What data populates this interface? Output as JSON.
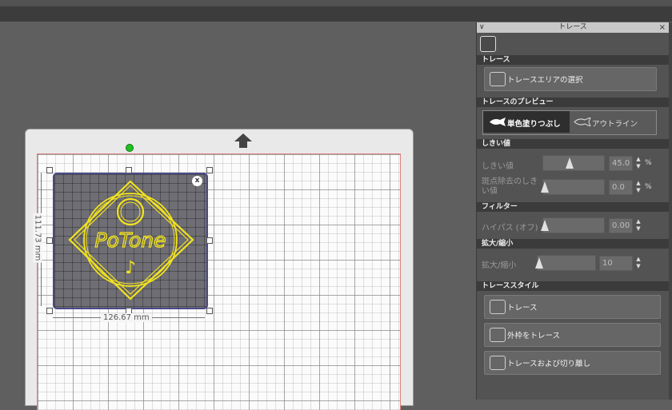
{
  "panel": {
    "title": "トレース",
    "sections": {
      "trace": "トレース",
      "preview": "トレースのプレビュー",
      "threshold": "しきい値",
      "filter": "フィルター",
      "scale": "拡大/縮小",
      "style": "トレーススタイル"
    },
    "select_area_button": "トレースエリアの選択",
    "preview_modes": {
      "fill": "単色塗りつぶし",
      "outline": "アウトライン"
    },
    "threshold": {
      "label": "しきい値",
      "value": "45.0",
      "unit": "%",
      "level": 0.45
    },
    "speckle": {
      "label": "斑点除去のしきい値",
      "value": "0.0",
      "unit": "%",
      "level": 0.0
    },
    "highpass": {
      "label": "ハイパス (オフ)",
      "value": "0.00",
      "level": 0.0
    },
    "scale": {
      "label": "拡大/縮小",
      "value": "10",
      "level": 0.0
    },
    "style_buttons": {
      "trace": "トレース",
      "outer": "外枠をトレース",
      "detach": "トレースおよび切り離し"
    }
  },
  "canvas": {
    "width_label": "126.67 mm",
    "height_label": "111.73 mm",
    "logo_text": "PoTone",
    "close_badge": "x",
    "colors": {
      "logo": "#f2e21d",
      "selection": "#4a4a8a"
    }
  }
}
